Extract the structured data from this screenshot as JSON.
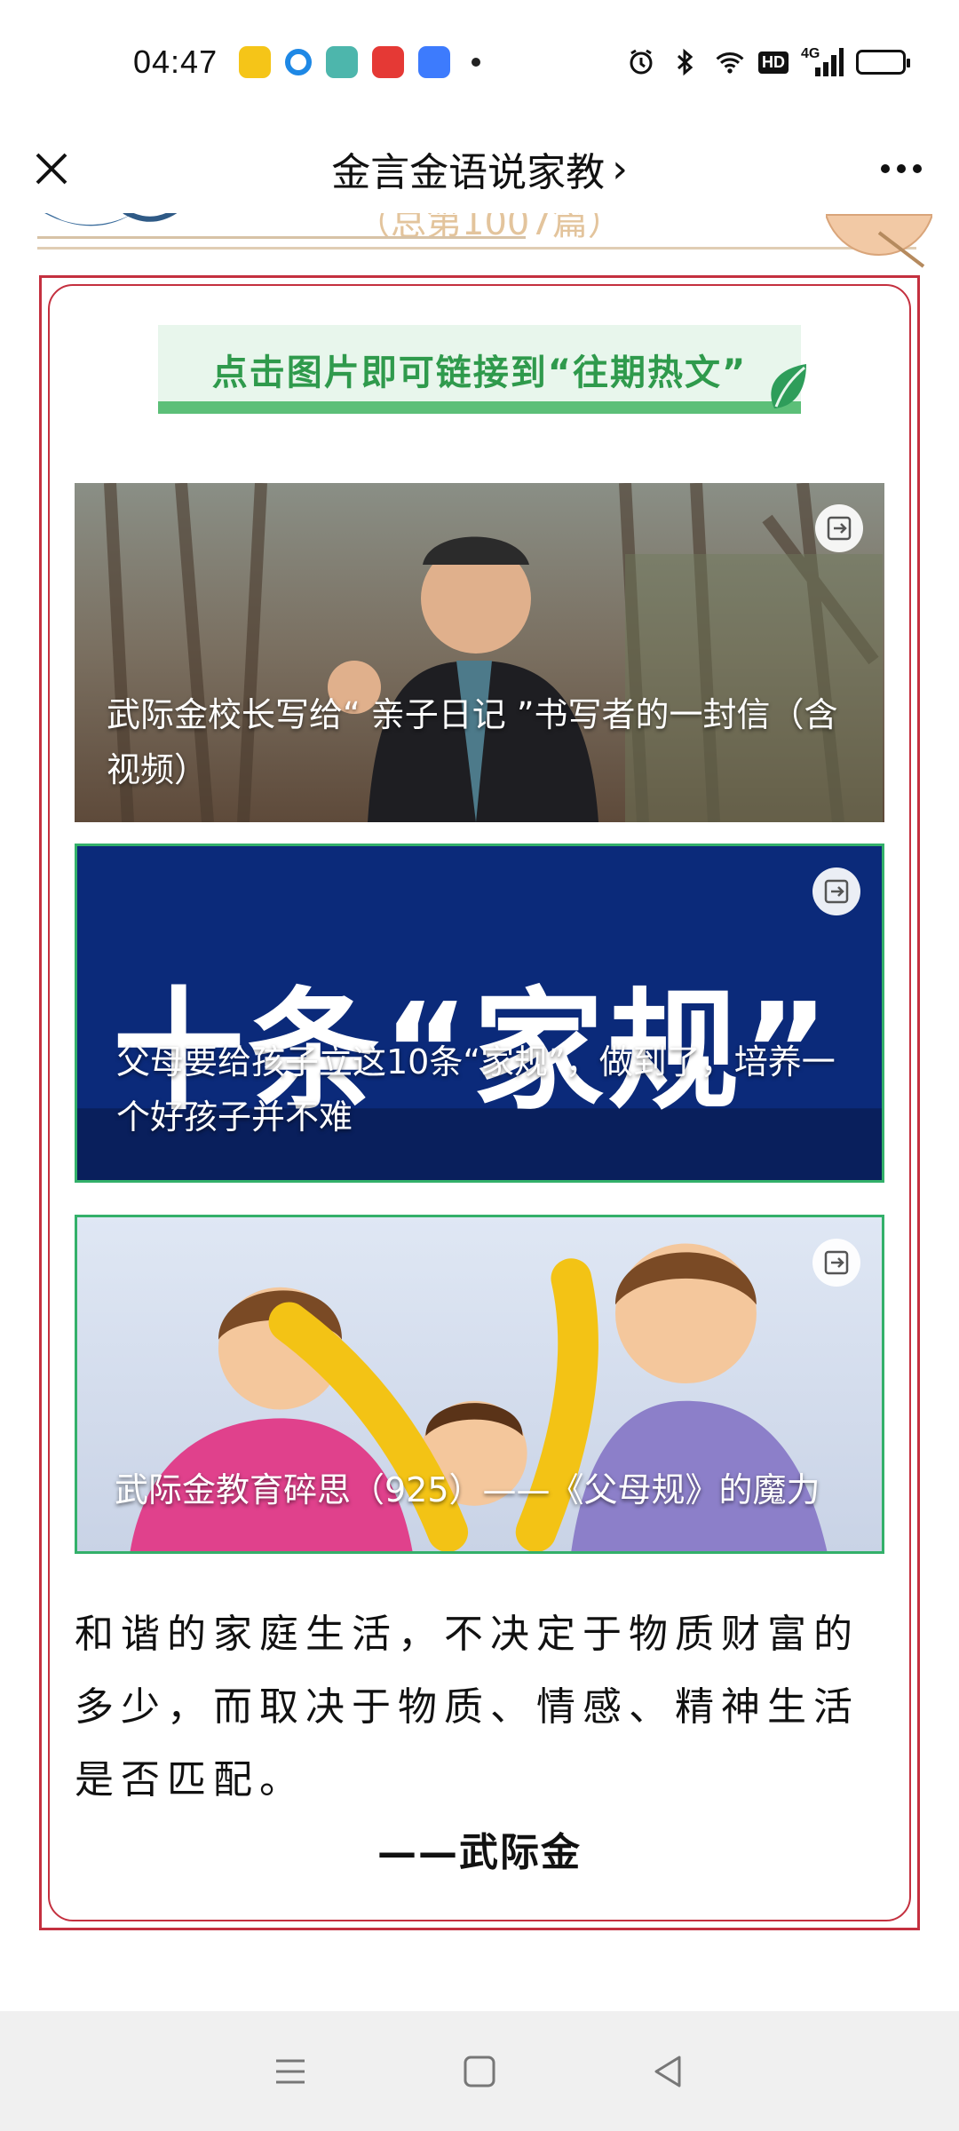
{
  "status": {
    "time": "04:47",
    "hd": "HD",
    "network": "4G"
  },
  "nav": {
    "title": "金言金语说家教",
    "chevron": "›"
  },
  "header_fragment": "（总第1007篇）",
  "banner": {
    "text": "点击图片即可链接到“往期热文”"
  },
  "articles": [
    {
      "title": "武际金校长写给“ 亲子日记 ”书写者的一封信（含视频）",
      "icon": "share-out-icon"
    },
    {
      "title": "父母要给孩子立这10条“家规”，做到了，培养一个好孩子并不难",
      "image_text": "十条“家规”",
      "icon": "share-out-icon"
    },
    {
      "title": "武际金教育碎思（925）——《父母规》的魔力",
      "icon": "share-out-icon"
    }
  ],
  "quote": {
    "text": "和谐的家庭生活，不决定于物质财富的多少，而取决于物质、情感、精神生活是否匹配。",
    "author": "——武际金"
  },
  "colors": {
    "frame": "#c4303f",
    "banner_bg": "#e8f6ec",
    "banner_text": "#2f9a4c",
    "card_border": "#33b06a",
    "card2_bg": "#0b2a7a"
  }
}
